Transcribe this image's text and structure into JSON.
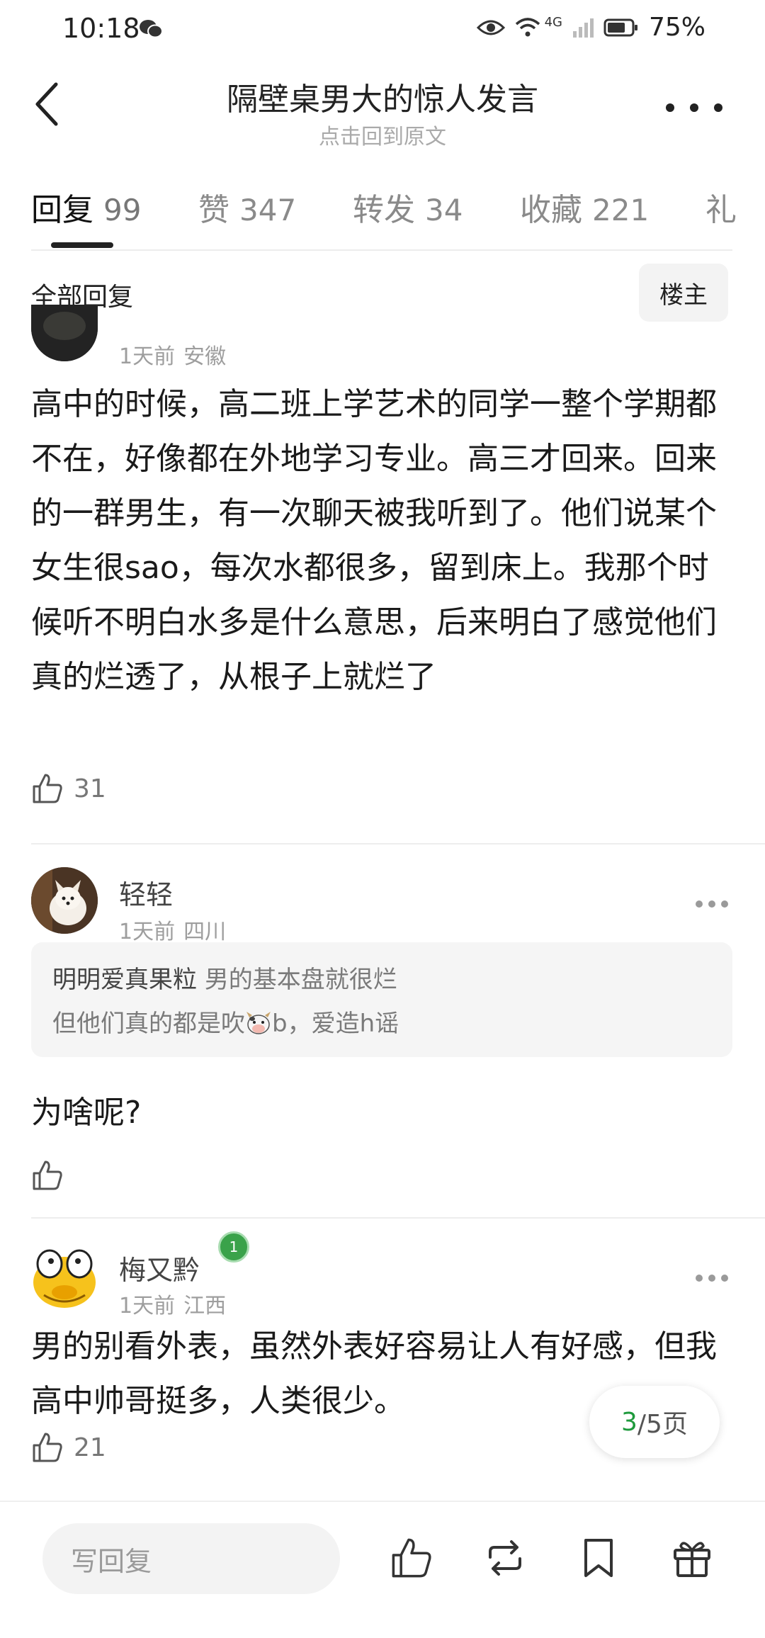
{
  "status_bar": {
    "time": "10:18",
    "network": "4G",
    "battery": "75%"
  },
  "header": {
    "title": "隔壁桌男大的惊人发言",
    "subtitle": "点击回到原文"
  },
  "tabs": [
    {
      "label": "回复",
      "count": "99"
    },
    {
      "label": "赞",
      "count": "347"
    },
    {
      "label": "转发",
      "count": "34"
    },
    {
      "label": "收藏",
      "count": "221"
    },
    {
      "label": "礼",
      "count": ""
    }
  ],
  "replies_section": {
    "title": "全部回复",
    "owner_filter": "楼主"
  },
  "comments": [
    {
      "time": "1天前",
      "location": "安徽",
      "text": "高中的时候，高二班上学艺术的同学一整个学期都不在，好像都在外地学习专业。高三才回来。回来的一群男生，有一次聊天被我听到了。他们说某个女生很sao，每次水都很多，留到床上。我那个时候听不明白水多是什么意思，后来明白了感觉他们真的烂透了，从根子上就烂了",
      "likes": "31"
    },
    {
      "username": "轻轻",
      "time": "1天前",
      "location": "四川",
      "quote": {
        "name": "明明爱真果粒",
        "line1": "男的基本盘就很烂",
        "line2_pre": "但他们真的都是吹",
        "line2_post": "b，爱造h谣"
      },
      "text": "为啥呢?",
      "likes": ""
    },
    {
      "username": "梅又黔",
      "level": "1",
      "time": "1天前",
      "location": "江西",
      "text": "男的别看外表，虽然外表好容易让人有好感，但我高中帅哥挺多，人类很少。",
      "likes": "21"
    }
  ],
  "pager": {
    "current": "3",
    "total_text": "/5页"
  },
  "bottom_bar": {
    "reply_placeholder": "写回复"
  },
  "colors": {
    "accent_green": "#1e9a3c",
    "level_badge": "#3aa24a"
  }
}
